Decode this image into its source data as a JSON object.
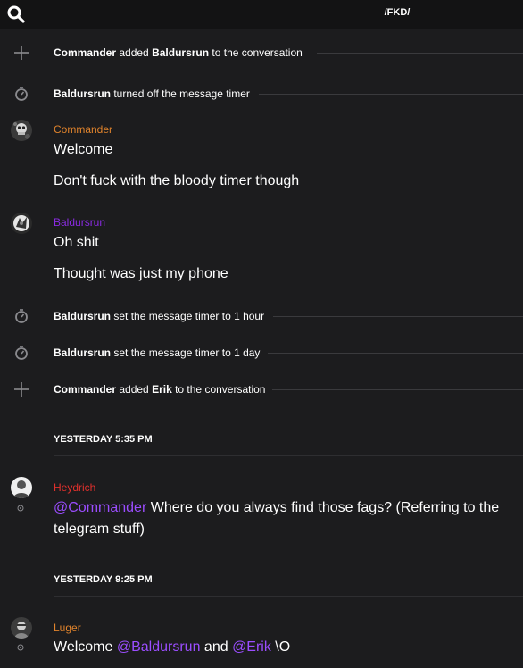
{
  "header": {
    "title": "/FKD/"
  },
  "colors": {
    "background": "#1c1c1e",
    "topbar": "#131314",
    "commander": "#e0832c",
    "baldursrun": "#8a2be2",
    "heydrich": "#e0302c",
    "luger": "#e0832c",
    "mention": "#9b4dff"
  },
  "events": [
    {
      "icon": "plus-icon",
      "actor": "Commander",
      "text": " added ",
      "target": "Baldursrun",
      "suffix": " to the conversation"
    },
    {
      "icon": "timer-icon",
      "actor": "Baldursrun",
      "text": " turned off the message timer"
    },
    {
      "icon": "timer-icon",
      "actor": "Baldursrun",
      "text": " set the message timer to 1 hour"
    },
    {
      "icon": "timer-icon",
      "actor": "Baldursrun",
      "text": " set the message timer to 1 day"
    },
    {
      "icon": "plus-icon",
      "actor": "Commander",
      "text": " added ",
      "target": "Erik",
      "suffix": " to the conversation"
    }
  ],
  "messages": {
    "commander": {
      "author": "Commander",
      "lines": [
        "Welcome",
        "Don't fuck with the bloody timer though"
      ]
    },
    "baldursrun": {
      "author": "Baldursrun",
      "lines": [
        "Oh shit",
        "Thought was just my phone"
      ]
    },
    "heydrich": {
      "author": "Heydrich",
      "mention": "@Commander",
      "text": " Where do you always find those fags? (Referring to the telegram stuff)"
    },
    "luger": {
      "author": "Luger",
      "prefix": "Welcome ",
      "mention1": "@Baldursrun",
      "middle": " and ",
      "mention2": "@Erik",
      "suffix": " \\O"
    }
  },
  "dates": {
    "first": "YESTERDAY 5:35 PM",
    "second": "YESTERDAY 9:25 PM"
  }
}
